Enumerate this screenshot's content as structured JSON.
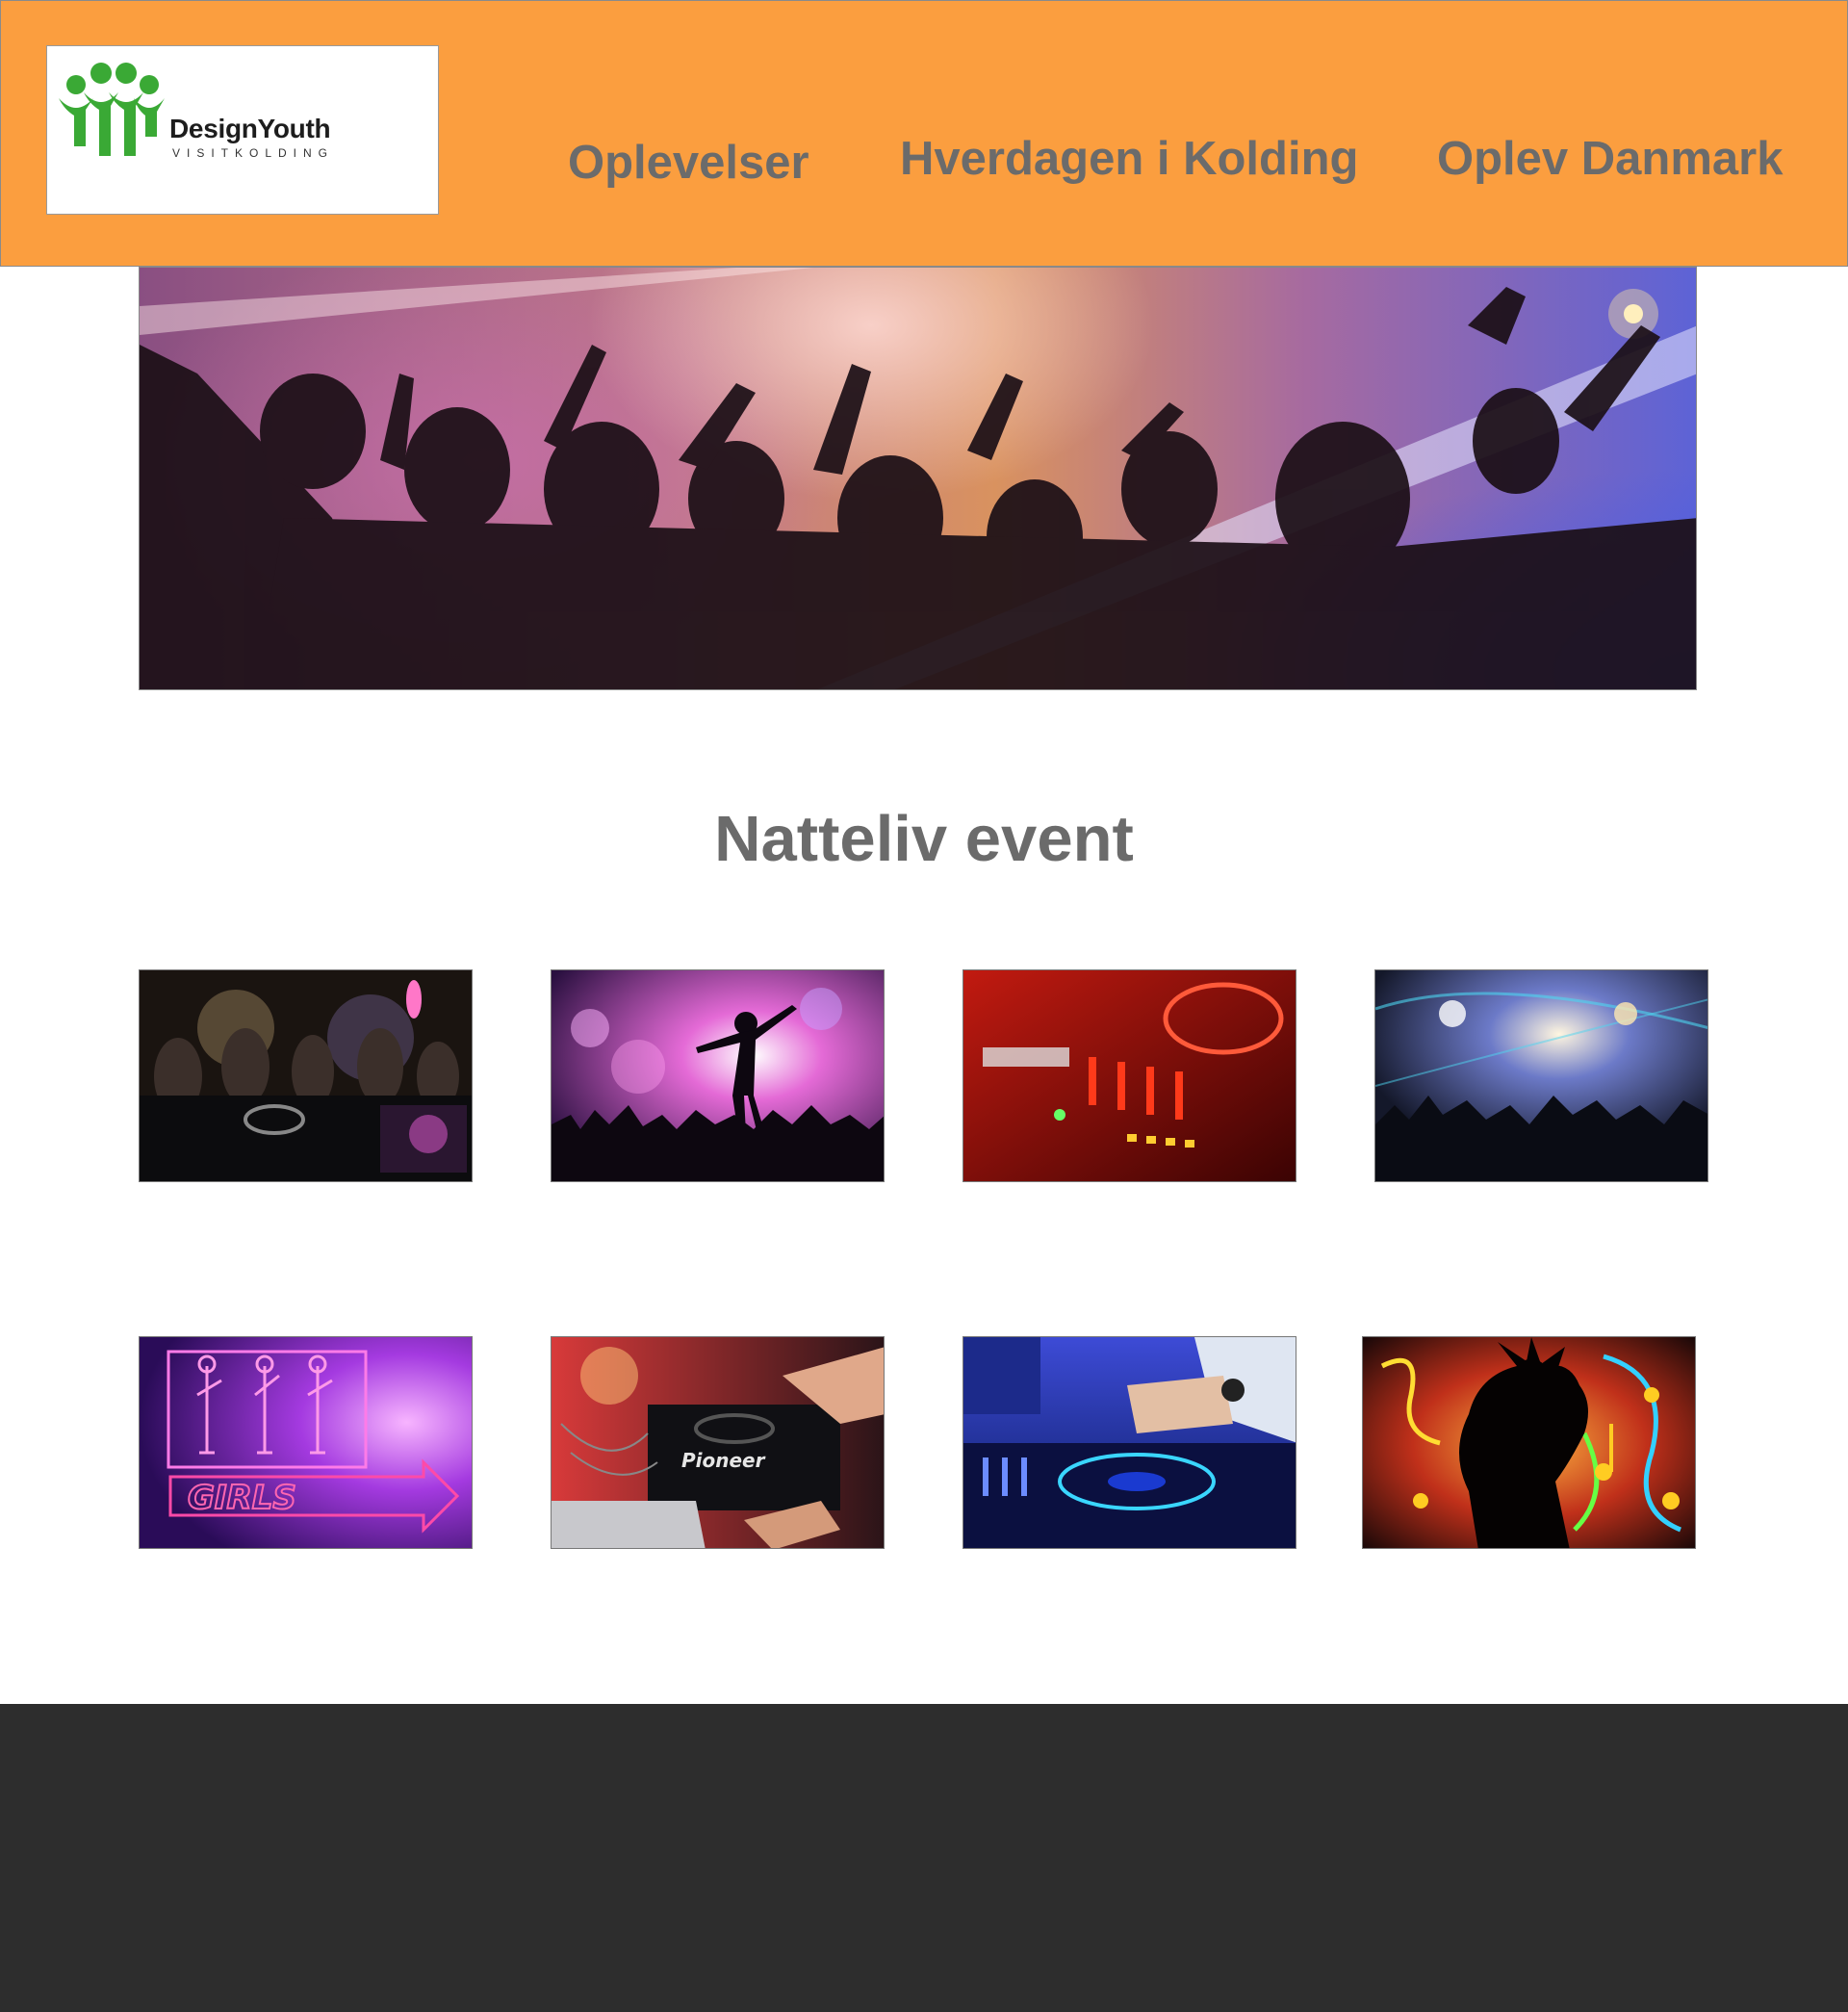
{
  "header": {
    "logo": {
      "name": "DesignYouth",
      "subtitle": "VISITKOLDING"
    },
    "nav": [
      {
        "label": "Oplevelser"
      },
      {
        "label": "Hverdagen i Kolding"
      },
      {
        "label": "Oplev Danmark"
      }
    ]
  },
  "main": {
    "title": "Natteliv event",
    "gallery": {
      "rows": [
        [
          "club-dj-crowd",
          "dancer-silhouette",
          "red-dj-mixer",
          "concert-crowd-blue"
        ],
        [
          "girls-neon-sign",
          "pioneer-dj-controller",
          "blue-dj-turntable",
          "music-notes-silhouette"
        ]
      ],
      "signs": {
        "girls": "GIRLS",
        "pioneer": "Pioneer"
      }
    }
  },
  "colors": {
    "header_bg": "#fb9e3f",
    "nav_text": "#6b6b6b",
    "logo_green": "#3aa935",
    "footer_bg": "#2d2d2d"
  }
}
